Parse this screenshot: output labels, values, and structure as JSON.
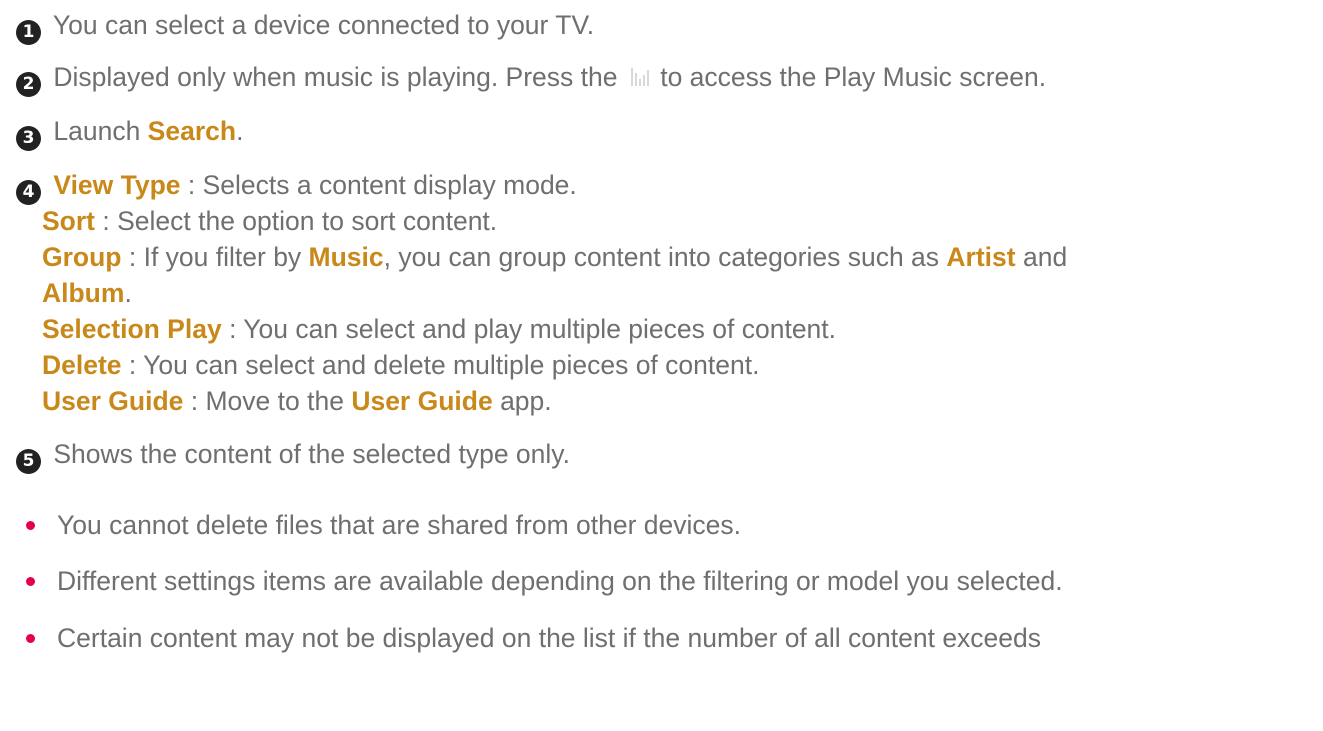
{
  "items": {
    "n1": {
      "num": "1",
      "text": " You can select a device connected to your TV."
    },
    "n2": {
      "num": "2",
      "text_before": " Displayed only when music is playing. Press the ",
      "text_after": " to access the Play Music screen.",
      "icon": "music-equalizer-icon"
    },
    "n3": {
      "num": "3",
      "pre": " Launch ",
      "link": "Search",
      "post": "."
    },
    "n4": {
      "num": "4",
      "view_type": {
        "term": "View Type",
        "desc": " : Selects a content display mode."
      },
      "sort": {
        "term": "Sort",
        "desc": " : Select the option to sort content."
      },
      "group": {
        "term": "Group",
        "desc1": " : If you filter by ",
        "music": "Music",
        "desc2": ", you can group content into categories such as ",
        "artist": "Artist",
        "desc3": " and",
        "album": "Album",
        "desc4": "."
      },
      "selection_play": {
        "term": "Selection Play",
        "desc": " : You can select and play multiple pieces of content."
      },
      "delete": {
        "term": "Delete",
        "desc": " : You can select and delete multiple pieces of content."
      },
      "user_guide": {
        "term": "User Guide",
        "desc1": " : Move to the ",
        "app": "User Guide",
        "desc2": " app."
      }
    },
    "n5": {
      "num": "5",
      "text": " Shows the content of the selected type only."
    }
  },
  "notes": [
    "You cannot delete files that are shared from other devices.",
    "Different settings items are available depending on the filtering or model you selected.",
    "Certain content may not be displayed on the list if the number of all content exceeds"
  ],
  "colors": {
    "highlight": "#c8891a",
    "bullet": "#e5004f",
    "text": "#6f6f6f",
    "number_circle": "#222222"
  }
}
